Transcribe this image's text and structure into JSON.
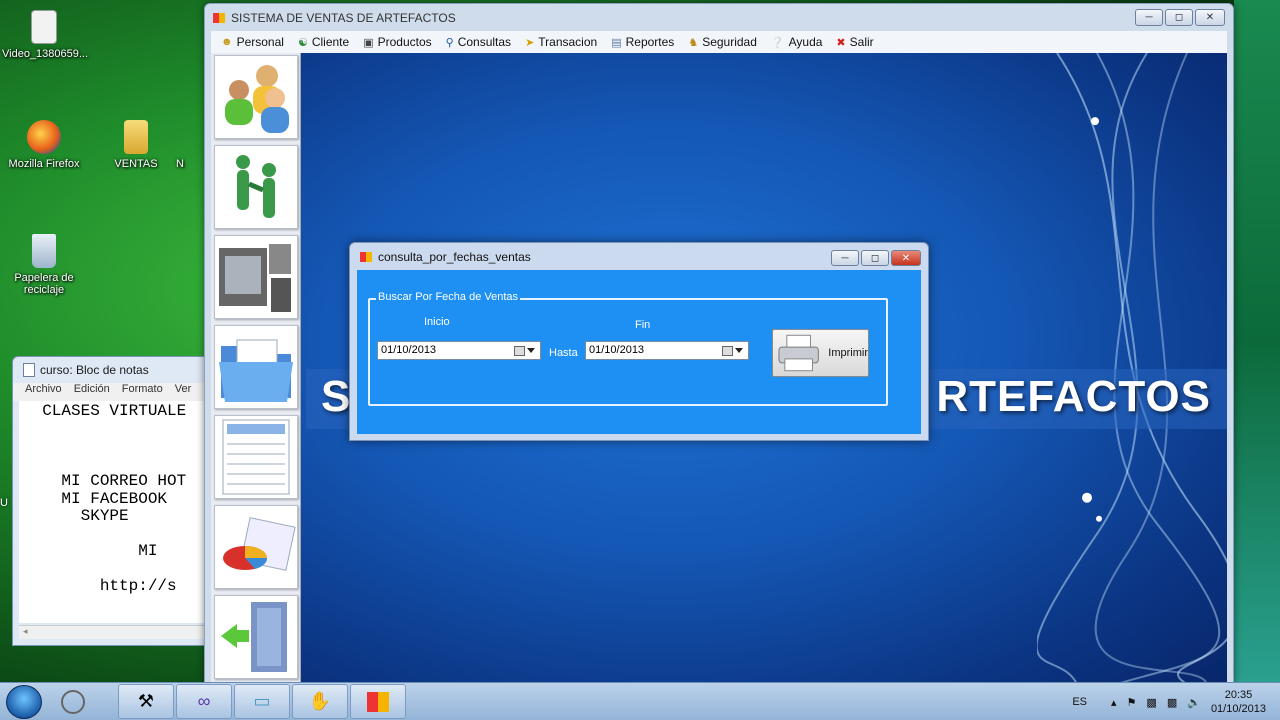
{
  "desktop": {
    "icons": [
      {
        "label": "Video_1380659...",
        "icon": "video-file-icon"
      },
      {
        "label": "Mozilla Firefox",
        "icon": "firefox-icon"
      },
      {
        "label": "VENTAS",
        "icon": "folder-icon"
      },
      {
        "label": "N",
        "icon": "partial-icon"
      },
      {
        "label": "Papelera de reciclaje",
        "icon": "recycle-bin-icon"
      }
    ],
    "edge_letter": "U"
  },
  "notepad": {
    "title": "curso: Bloc de notas",
    "menu": [
      "Archivo",
      "Edición",
      "Formato",
      "Ver"
    ],
    "lines": [
      "  CLASES VIRTUALE",
      "",
      "",
      "",
      "    MI CORREO HOT",
      "    MI FACEBOOK",
      "      SKYPE",
      "",
      "            MI",
      "",
      "        http://s"
    ]
  },
  "main_window": {
    "title": "SISTEMA DE VENTAS  DE ARTEFACTOS",
    "menu": [
      {
        "label": "Personal",
        "icon": "people-icon"
      },
      {
        "label": "Cliente",
        "icon": "handshake-icon"
      },
      {
        "label": "Productos",
        "icon": "products-icon"
      },
      {
        "label": "Consultas",
        "icon": "search-icon"
      },
      {
        "label": "Transacion",
        "icon": "transaction-icon"
      },
      {
        "label": "Reportes",
        "icon": "report-icon"
      },
      {
        "label": "Seguridad",
        "icon": "padlock-icon"
      },
      {
        "label": "Ayuda",
        "icon": "help-icon"
      },
      {
        "label": "Salir",
        "icon": "exit-icon"
      }
    ],
    "banner_left": "S",
    "banner_right": "RTEFACTOS"
  },
  "dialog": {
    "title": "consulta_por_fechas_ventas",
    "group_title": "Buscar Por Fecha de Ventas",
    "label_inicio": "Inicio",
    "label_fin": "Fin",
    "label_hasta": "Hasta",
    "fecha_inicio": "01/10/2013",
    "fecha_fin": "01/10/2013",
    "print_label": "Imprimir"
  },
  "taskbar": {
    "language": "ES",
    "time": "20:35",
    "date": "01/10/2013"
  },
  "colors": {
    "dialog_body": "#1e8ff3",
    "client_bg": "#1456b3"
  }
}
